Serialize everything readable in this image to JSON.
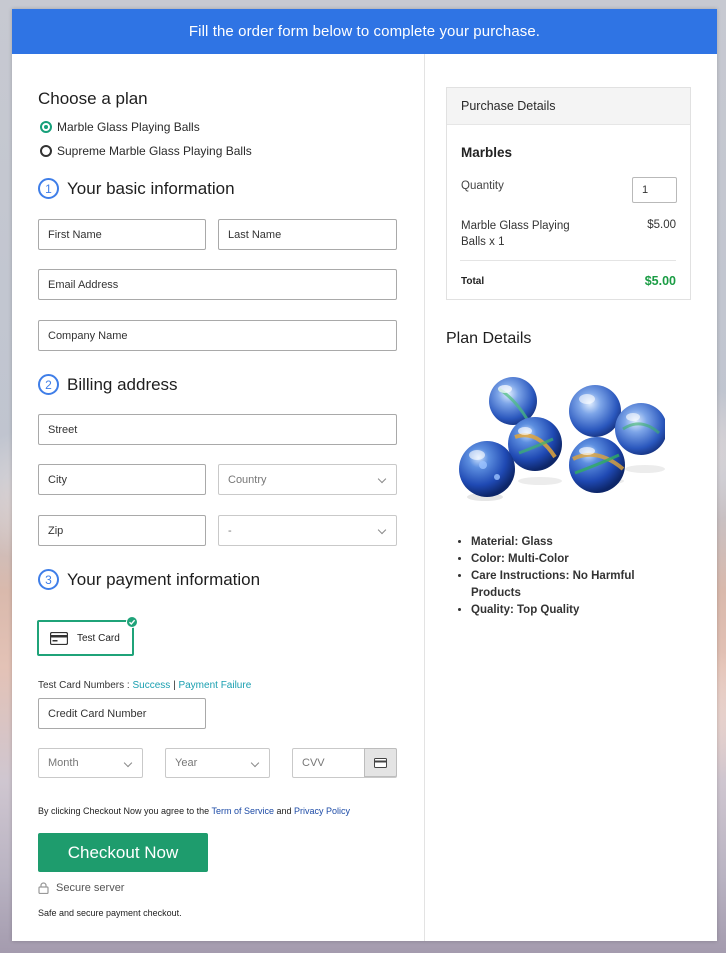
{
  "banner": {
    "text": "Fill the order form below to complete your purchase."
  },
  "plan": {
    "heading": "Choose a plan",
    "options": [
      {
        "label": "Marble Glass Playing Balls",
        "selected": true
      },
      {
        "label": "Supreme Marble Glass Playing Balls",
        "selected": false
      }
    ]
  },
  "basic": {
    "step": "1",
    "heading": "Your basic information",
    "first_name": "First Name",
    "last_name": "Last Name",
    "email": "Email Address",
    "company": "Company Name"
  },
  "billing": {
    "step": "2",
    "heading": "Billing address",
    "street": "Street",
    "city": "City",
    "country": "Country",
    "zip": "Zip",
    "state": "-"
  },
  "payment": {
    "step": "3",
    "heading": "Your payment information",
    "test_card_label": "Test Card",
    "test_numbers_prefix": "Test Card Numbers : ",
    "success_link": "Success",
    "separator": "|",
    "failure_link": "Payment Failure",
    "card_number": "Credit Card Number",
    "month": "Month",
    "year": "Year",
    "cvv": "CVV"
  },
  "agreement": {
    "prefix": "By clicking Checkout Now you agree to the ",
    "terms": "Term of Service",
    "and": " and ",
    "privacy": "Privacy Policy"
  },
  "checkout": {
    "button": "Checkout Now",
    "secure": "Secure server",
    "safe": "Safe and secure payment checkout."
  },
  "purchase": {
    "heading": "Purchase Details",
    "product": "Marbles",
    "quantity_label": "Quantity",
    "quantity": "1",
    "item_line1": "Marble Glass Playing",
    "item_line2": "Balls x 1",
    "item_price": "$5.00",
    "total_label": "Total",
    "total": "$5.00"
  },
  "plan_details": {
    "heading": "Plan Details",
    "features": [
      "Material: Glass",
      "Color: Multi-Color",
      "Care Instructions: No Harmful Products",
      "Quality: Top Quality"
    ]
  },
  "colors": {
    "banner": "#2f74e4",
    "accent_green": "#1e9c6d",
    "step_blue": "#3f7ee8",
    "link_teal": "#199fb0",
    "link_blue": "#1d4ba6",
    "total_green": "#1a9c44"
  }
}
